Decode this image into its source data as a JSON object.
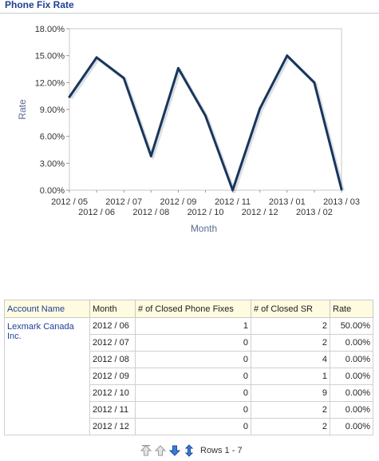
{
  "header": {
    "title": "Phone Fix Rate"
  },
  "chart_data": {
    "type": "line",
    "xlabel": "Month",
    "ylabel": "Rate",
    "ylim": [
      0,
      18
    ],
    "yticks": [
      "0.00%",
      "3.00%",
      "6.00%",
      "9.00%",
      "12.00%",
      "15.00%",
      "18.00%"
    ],
    "xtick_labels": [
      "2012 / 05",
      "2012 / 06",
      "2012 / 07",
      "2012 / 08",
      "2012 / 09",
      "2012 / 10",
      "2012 / 11",
      "2012 / 12",
      "2013 / 01",
      "2013 / 02",
      "2013 / 03"
    ],
    "series": [
      {
        "values": [
          10.4,
          14.8,
          12.5,
          3.8,
          13.6,
          8.3,
          0.0,
          9.1,
          15.0,
          12.0,
          0.1
        ]
      }
    ],
    "line_color": "#17365d"
  },
  "table": {
    "columns": [
      "Account Name",
      "Month",
      "# of Closed Phone Fixes",
      "# of Closed SR",
      "Rate"
    ],
    "account": "Lexmark Canada Inc.",
    "rows": [
      {
        "month": "2012 / 06",
        "fixes": "1",
        "sr": "2",
        "rate": "50.00%"
      },
      {
        "month": "2012 / 07",
        "fixes": "0",
        "sr": "2",
        "rate": "0.00%"
      },
      {
        "month": "2012 / 08",
        "fixes": "0",
        "sr": "4",
        "rate": "0.00%"
      },
      {
        "month": "2012 / 09",
        "fixes": "0",
        "sr": "1",
        "rate": "0.00%"
      },
      {
        "month": "2012 / 10",
        "fixes": "0",
        "sr": "9",
        "rate": "0.00%"
      },
      {
        "month": "2012 / 11",
        "fixes": "0",
        "sr": "2",
        "rate": "0.00%"
      },
      {
        "month": "2012 / 12",
        "fixes": "0",
        "sr": "2",
        "rate": "0.00%"
      }
    ]
  },
  "pager": {
    "rows_label": "Rows 1 - 7"
  }
}
